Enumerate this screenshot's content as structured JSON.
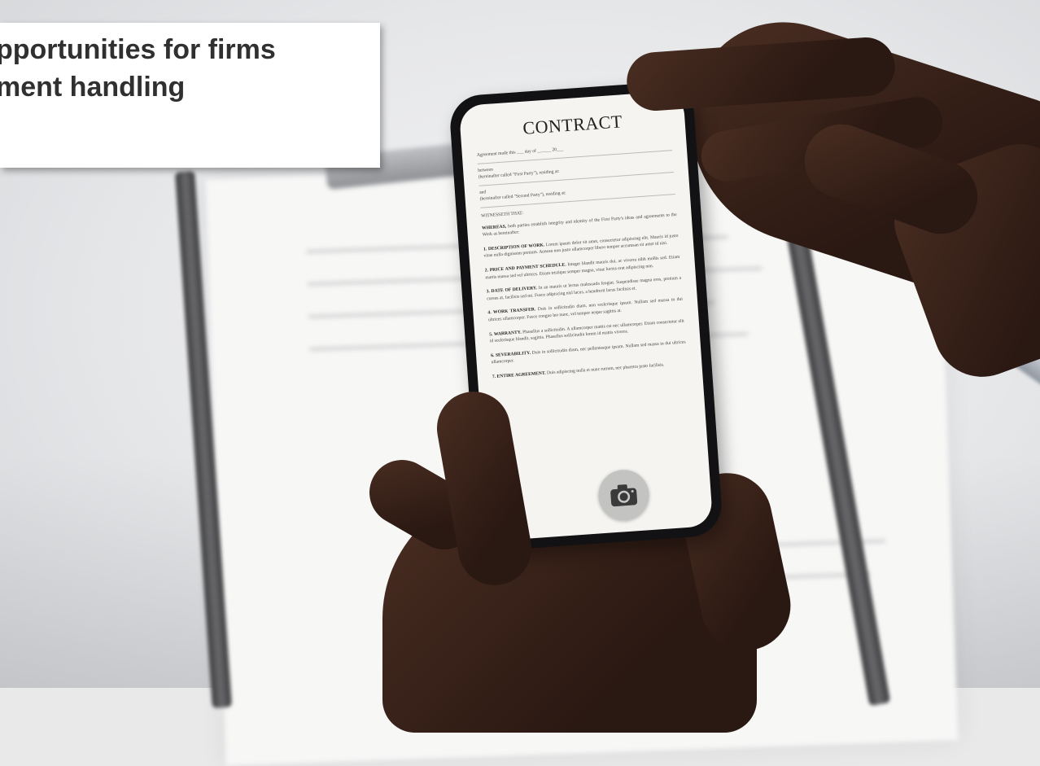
{
  "caption": {
    "line1": "pportunities for firms",
    "line2": "ment handling"
  },
  "phone": {
    "document_title": "CONTRACT",
    "header_lines": [
      "Agreement made this ___ day of ______ 20___",
      "between",
      "(hereinafter called \"First Party\"), residing at:",
      "and",
      "(hereinafter called \"Second Party\"), residing at:"
    ],
    "witnesseth": "WITNESSETH THAT:",
    "sections": [
      {
        "heading": "WHEREAS,",
        "body": "both parties establish integrity and identity of the First Party's ideas and agreements to the Work as hereinafter:"
      },
      {
        "heading": "1. DESCRIPTION OF WORK.",
        "body": "Lorem ipsum dolor sit amet, consectetur adipiscing elit. Mauris id justo vitae nulla dignissim pretium. Aenean non justo ullamcorper libero tempor accumsan sit amet id nisi."
      },
      {
        "heading": "2. PRICE AND PAYMENT SCHEDULE.",
        "body": "Integer blandit mauris dui, ac viverra nibh mollis sed. Etiam mattis massa sed vel ultrices. Etiam tristique semper magna, vitae luctus erat adipiscing non."
      },
      {
        "heading": "3. DATE OF DELIVERY.",
        "body": "In an mauris ut lectus malesuada feugiat. Suspendisse magna eros, pretium a cursus at, facilisis sed mi. Fusce adipiscing nisl lacus, a hendrerit lacus facilisis et."
      },
      {
        "heading": "4. WORK TRANSFER.",
        "body": "Duis in sollicitudin diam, non scelerisque ipsum. Nullam sed massa in dui ultrices ullamcorper. Fusce congue leo nunc, vel tempor neque sagittis at."
      },
      {
        "heading": "5. WARRANTY.",
        "body": "Phasellus a sollicitudin. A ullamcorper mattis est nec ullamcorper. Etiam consectetur elit id scelerisque blandit, sagittis. Phasellus sollicitudin lorem id mattis viverra."
      },
      {
        "heading": "6. SEVERABILITY.",
        "body": "Duis in sollicitudin diam, nec pellentesque ipsum. Nullam sed massa in dui ultrices ullamcorper."
      },
      {
        "heading": "7. ENTIRE AGREEMENT.",
        "body": "Duis adipiscing nulla et nunc rutrum, nec pharetra justo facilisis."
      }
    ],
    "camera_button_icon": "camera-icon"
  }
}
